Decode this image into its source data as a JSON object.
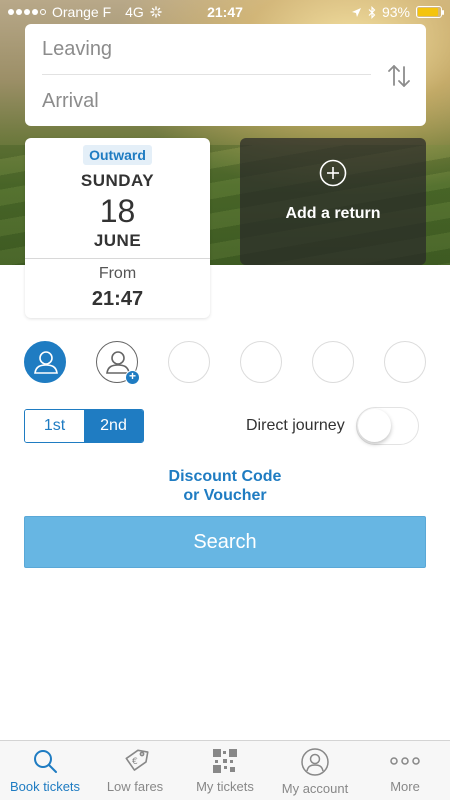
{
  "status_bar": {
    "carrier": "Orange F",
    "network": "4G",
    "time": "21:47",
    "battery": "93%",
    "battery_level": 0.93
  },
  "route": {
    "leaving_placeholder": "Leaving",
    "arrival_placeholder": "Arrival"
  },
  "outward": {
    "badge": "Outward",
    "day_name": "SUNDAY",
    "day_number": "18",
    "month": "JUNE",
    "from_label": "From",
    "from_time": "21:47"
  },
  "return": {
    "label": "Add a return"
  },
  "travel_class": {
    "first": "1st",
    "second": "2nd",
    "selected": "2nd"
  },
  "direct_journey": {
    "label": "Direct journey",
    "enabled": false
  },
  "discount": {
    "line1": "Discount Code",
    "line2": "or Voucher"
  },
  "search": {
    "label": "Search"
  },
  "tabs": [
    {
      "label": "Book tickets",
      "icon": "search-icon",
      "active": true
    },
    {
      "label": "Low fares",
      "icon": "price-tag-icon",
      "active": false
    },
    {
      "label": "My tickets",
      "icon": "qr-code-icon",
      "active": false
    },
    {
      "label": "My account",
      "icon": "user-icon",
      "active": false
    },
    {
      "label": "More",
      "icon": "more-dots-icon",
      "active": false
    }
  ],
  "colors": {
    "accent": "#1f7cc2",
    "search_button": "#67b6e3",
    "battery": "#f4c40d"
  }
}
